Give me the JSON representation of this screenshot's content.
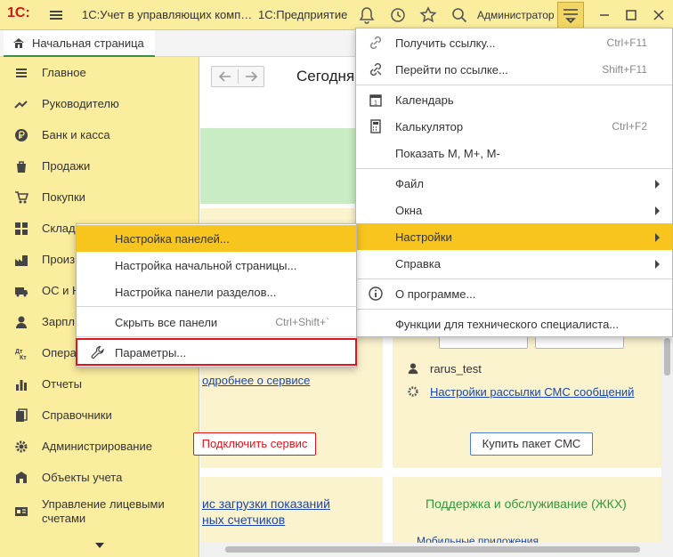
{
  "titlebar": {
    "logo": "1С:",
    "title": "1С:Учет в управляющих комп…",
    "platform": "1С:Предприятие",
    "user": "Администратор",
    "icons": [
      "bell-icon",
      "history-icon",
      "star-icon",
      "search-icon",
      "main-menu-icon",
      "minimize-icon",
      "maximize-icon",
      "close-icon"
    ]
  },
  "tabs": {
    "home": "Начальная страница"
  },
  "sidebar": {
    "items": [
      {
        "label": "Главное",
        "icon": "list-icon"
      },
      {
        "label": "Руководителю",
        "icon": "trend-icon"
      },
      {
        "label": "Банк и касса",
        "icon": "ruble-icon"
      },
      {
        "label": "Продажи",
        "icon": "bag-icon"
      },
      {
        "label": "Покупки",
        "icon": "cart-icon"
      },
      {
        "label": "Склад",
        "icon": "warehouse-icon"
      },
      {
        "label": "Произ",
        "icon": "production-icon"
      },
      {
        "label": "ОС и Н",
        "icon": "assets-icon"
      },
      {
        "label": "Зарпл",
        "icon": "person-icon"
      },
      {
        "label": "Опера",
        "icon": "operations-icon"
      },
      {
        "label": "Отчеты",
        "icon": "reports-icon"
      },
      {
        "label": "Справочники",
        "icon": "books-icon"
      },
      {
        "label": "Администрирование",
        "icon": "gear-icon"
      },
      {
        "label": "Объекты учета",
        "icon": "objects-icon"
      },
      {
        "label": "Управление лицевыми счетами",
        "icon": "accounts-icon"
      }
    ]
  },
  "main": {
    "today": "Сегодня",
    "more_about_service": "одробнее о сервисе",
    "connect_service": "Подключить сервис",
    "user_name": "rarus_test",
    "sms_settings": "Настройки рассылки СМС сообщений",
    "buy_sms": "Купить пакет СМС",
    "meter_loading_1": "ис загрузки показаний",
    "meter_loading_2": "ных счетчиков",
    "support_title": "Поддержка и обслуживание (ЖКХ)",
    "mobile_apps": "Мобильные приложения"
  },
  "main_menu": {
    "items": [
      {
        "label": "Получить ссылку...",
        "shortcut": "Ctrl+F11",
        "icon": "link-icon"
      },
      {
        "label": "Перейти по ссылке...",
        "shortcut": "Shift+F11",
        "icon": "goto-link-icon"
      },
      {
        "label": "Календарь",
        "shortcut": "",
        "icon": "calendar-icon"
      },
      {
        "label": "Калькулятор",
        "shortcut": "Ctrl+F2",
        "icon": "calculator-icon"
      },
      {
        "label": "Показать М, М+, М-",
        "shortcut": "",
        "icon": ""
      },
      {
        "label": "Файл",
        "shortcut": "",
        "icon": ""
      },
      {
        "label": "Окна",
        "shortcut": "",
        "icon": ""
      },
      {
        "label": "Настройки",
        "shortcut": "",
        "icon": ""
      },
      {
        "label": "Справка",
        "shortcut": "",
        "icon": ""
      },
      {
        "label": "О программе...",
        "shortcut": "",
        "icon": "info-icon"
      },
      {
        "label": "Функции для технического специалиста...",
        "shortcut": "",
        "icon": ""
      }
    ]
  },
  "settings_submenu": {
    "items": [
      {
        "label": "Настройка панелей...",
        "shortcut": ""
      },
      {
        "label": "Настройка начальной страницы...",
        "shortcut": ""
      },
      {
        "label": "Настройка панели разделов...",
        "shortcut": ""
      },
      {
        "label": "Скрыть все панели",
        "shortcut": "Ctrl+Shift+`"
      },
      {
        "label": "Параметры...",
        "shortcut": ""
      }
    ]
  },
  "colors": {
    "sidebar_bg": "#fbed9e",
    "highlight": "#f7c51e",
    "link": "#1c46a8",
    "accent_red": "#e3141c",
    "support_green": "#2e9a3c"
  }
}
